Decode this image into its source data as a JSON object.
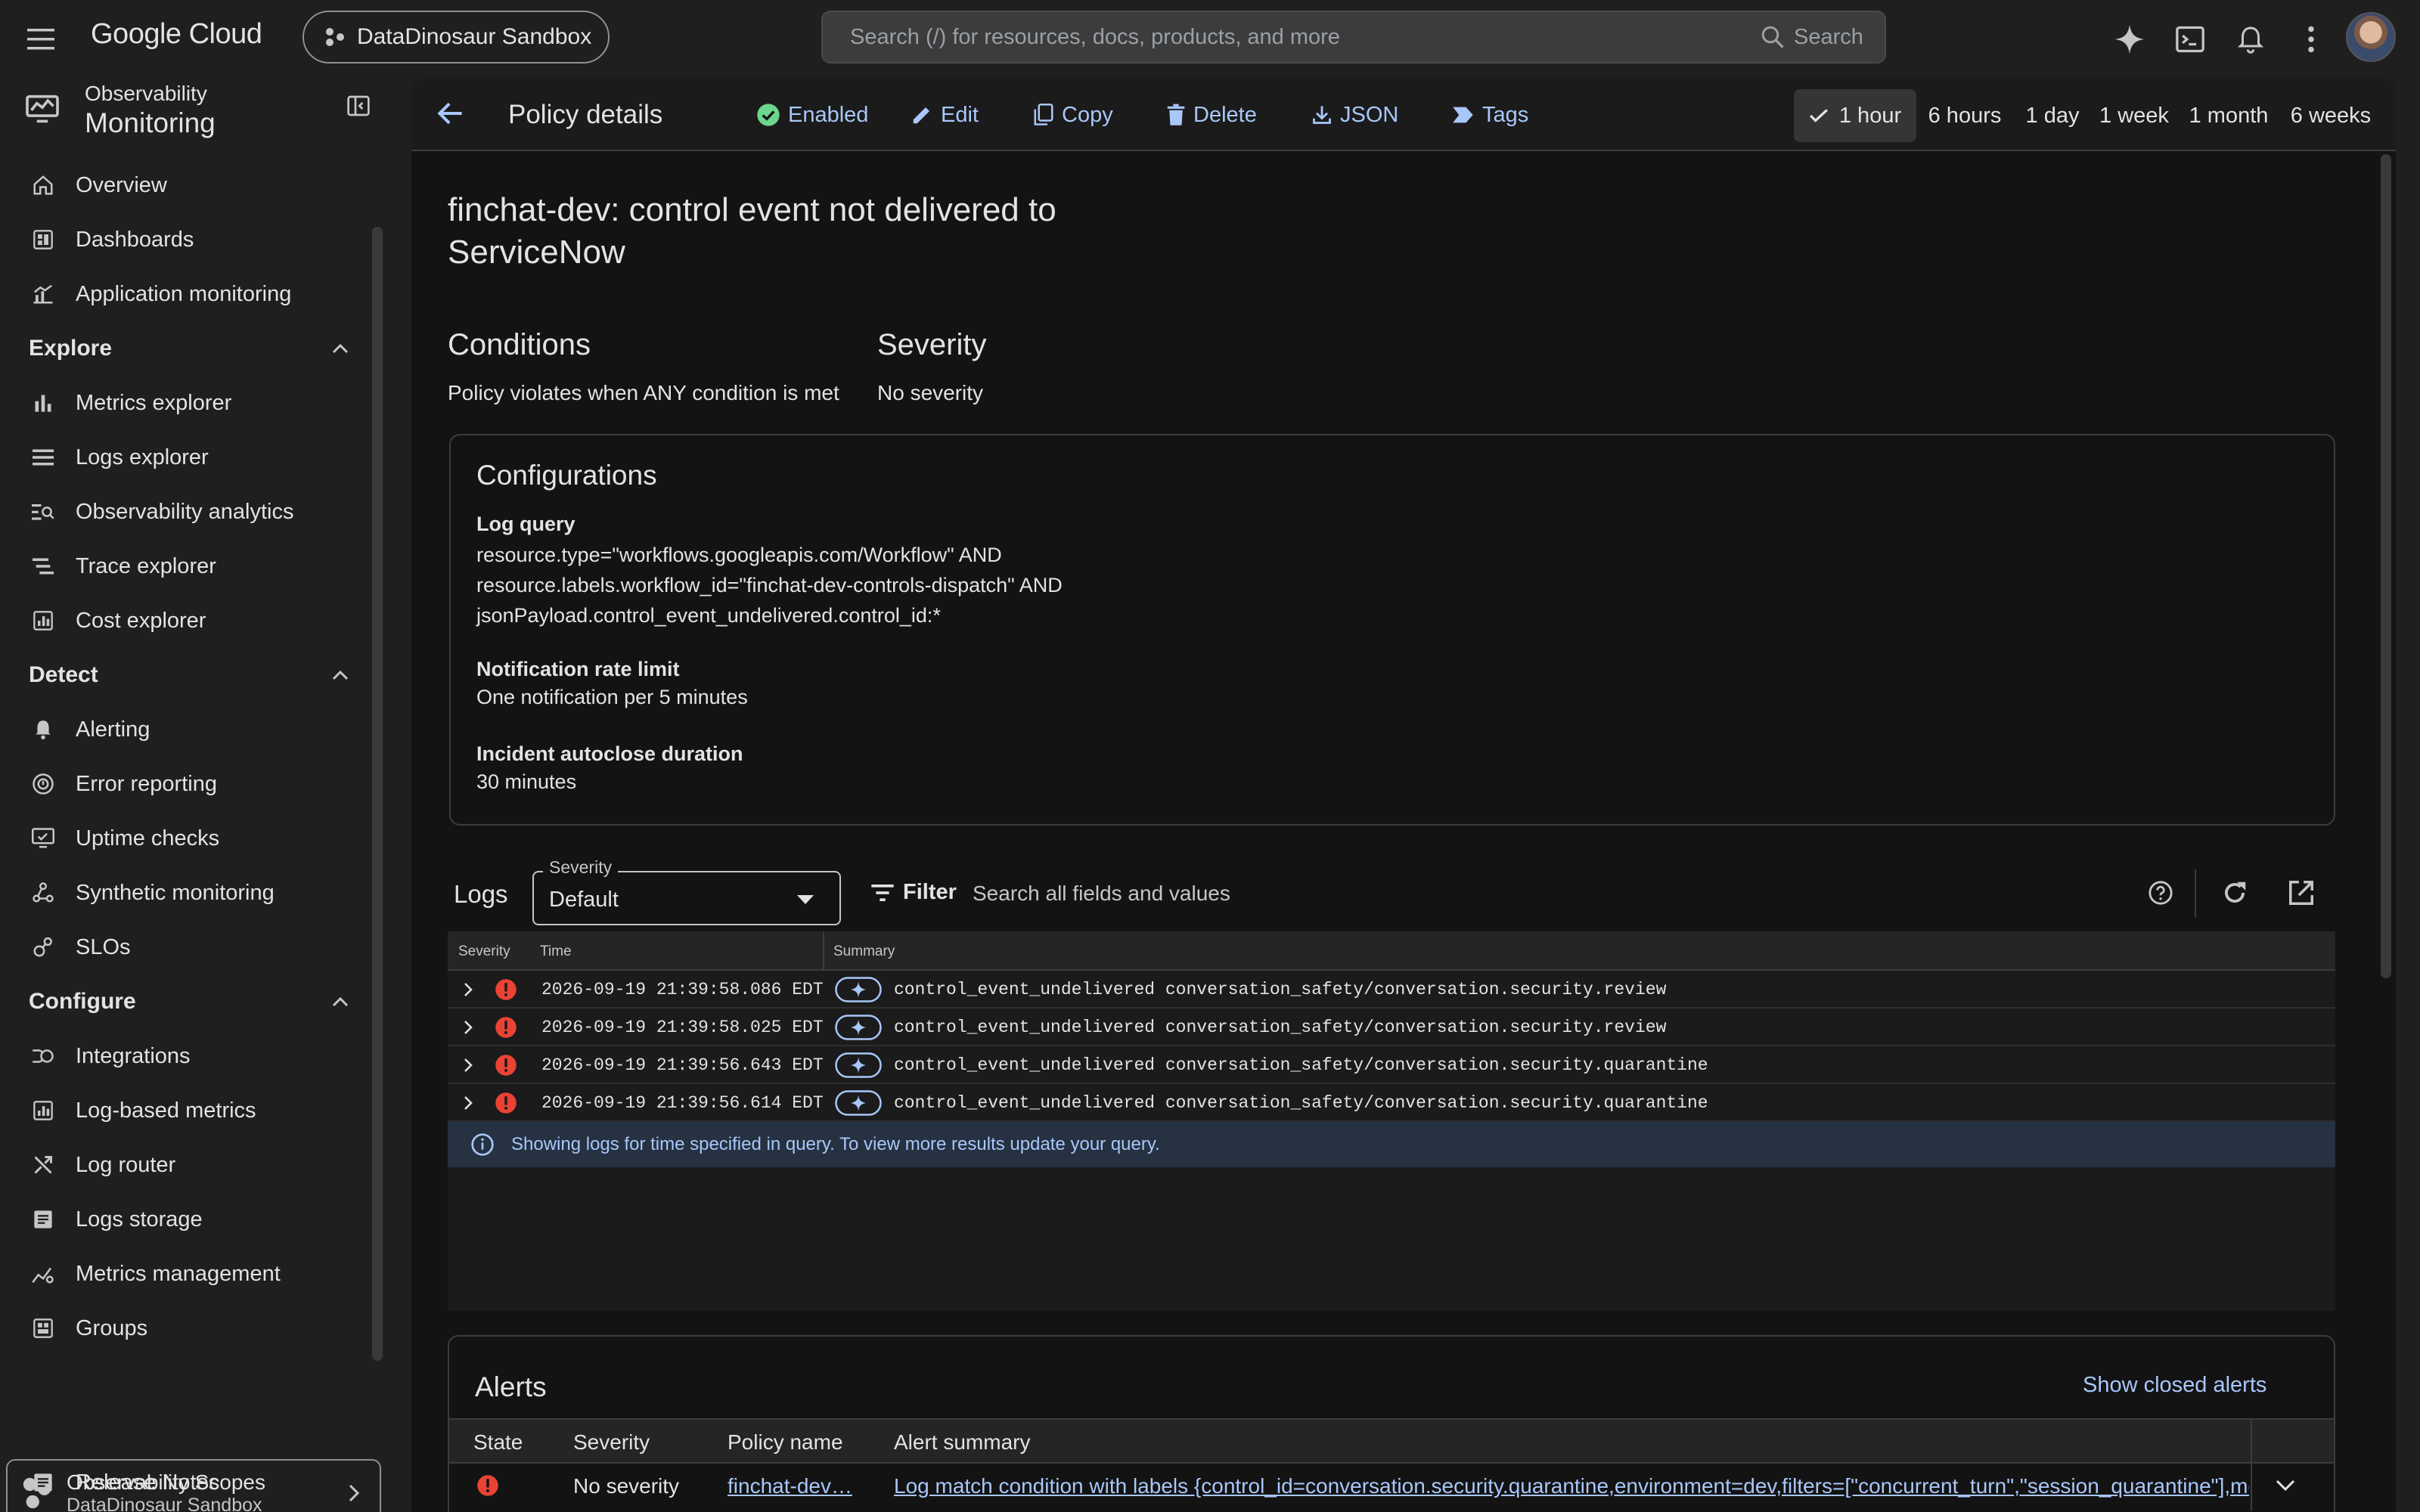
{
  "topbar": {
    "logo": "Google Cloud",
    "project": "DataDinosaur Sandbox",
    "search_placeholder": "Search (/) for resources, docs, products, and more",
    "search_button": "Search"
  },
  "sidebar": {
    "product_sub": "Observability",
    "product_title": "Monitoring",
    "items_top": [
      {
        "label": "Overview",
        "icon": "home-icon"
      },
      {
        "label": "Dashboards",
        "icon": "dashboard-icon"
      },
      {
        "label": "Application monitoring",
        "icon": "app-monitoring-icon"
      }
    ],
    "sections": [
      {
        "title": "Explore",
        "items": [
          {
            "label": "Metrics explorer",
            "icon": "bar-chart-icon"
          },
          {
            "label": "Logs explorer",
            "icon": "list-icon"
          },
          {
            "label": "Observability analytics",
            "icon": "analytics-icon"
          },
          {
            "label": "Trace explorer",
            "icon": "trace-icon"
          },
          {
            "label": "Cost explorer",
            "icon": "cost-icon"
          }
        ]
      },
      {
        "title": "Detect",
        "items": [
          {
            "label": "Alerting",
            "icon": "bell-icon"
          },
          {
            "label": "Error reporting",
            "icon": "error-icon"
          },
          {
            "label": "Uptime checks",
            "icon": "uptime-icon"
          },
          {
            "label": "Synthetic monitoring",
            "icon": "synthetic-icon"
          },
          {
            "label": "SLOs",
            "icon": "slo-icon"
          }
        ]
      },
      {
        "title": "Configure",
        "items": [
          {
            "label": "Integrations",
            "icon": "integrations-icon"
          },
          {
            "label": "Log-based metrics",
            "icon": "log-metrics-icon"
          },
          {
            "label": "Log router",
            "icon": "router-icon"
          },
          {
            "label": "Logs storage",
            "icon": "storage-icon"
          },
          {
            "label": "Metrics management",
            "icon": "metrics-mgmt-icon"
          },
          {
            "label": "Groups",
            "icon": "groups-icon"
          }
        ]
      }
    ],
    "scope_title": "Observability Scopes",
    "scope_sub": "DataDinosaur Sandbox",
    "release_notes": "Release Notes"
  },
  "toolbar": {
    "title": "Policy details",
    "enabled": "Enabled",
    "edit": "Edit",
    "copy": "Copy",
    "delete": "Delete",
    "json": "JSON",
    "tags": "Tags",
    "time_ranges": [
      "1 hour",
      "6 hours",
      "1 day",
      "1 week",
      "1 month",
      "6 weeks"
    ],
    "selected_time_range": "1 hour"
  },
  "policy": {
    "name_line1": "finchat-dev: control event not delivered to",
    "name_line2": "ServiceNow",
    "conditions_title": "Conditions",
    "conditions_value": "Policy violates when ANY condition is met",
    "severity_title": "Severity",
    "severity_value": "No severity"
  },
  "configurations": {
    "title": "Configurations",
    "log_query_label": "Log query",
    "log_query_lines": [
      "resource.type=\"workflows.googleapis.com/Workflow\" AND",
      "resource.labels.workflow_id=\"finchat-dev-controls-dispatch\" AND",
      "jsonPayload.control_event_undelivered.control_id:*"
    ],
    "rate_limit_label": "Notification rate limit",
    "rate_limit_value": "One notification per 5 minutes",
    "autoclose_label": "Incident autoclose duration",
    "autoclose_value": "30 minutes"
  },
  "logs": {
    "title": "Logs",
    "severity_legend": "Severity",
    "severity_value": "Default",
    "filter_label": "Filter",
    "search_placeholder": "Search all fields and values",
    "columns": [
      "Severity",
      "Time",
      "Summary"
    ],
    "rows": [
      {
        "time": "2026-09-19 21:39:58.086 EDT",
        "summary": "control_event_undelivered conversation_safety/conversation.security.review"
      },
      {
        "time": "2026-09-19 21:39:58.025 EDT",
        "summary": "control_event_undelivered conversation_safety/conversation.security.review"
      },
      {
        "time": "2026-09-19 21:39:56.643 EDT",
        "summary": "control_event_undelivered conversation_safety/conversation.security.quarantine"
      },
      {
        "time": "2026-09-19 21:39:56.614 EDT",
        "summary": "control_event_undelivered conversation_safety/conversation.security.quarantine"
      }
    ],
    "info": "Showing logs for time specified in query. To view more results update your query."
  },
  "alerts": {
    "title": "Alerts",
    "show_closed": "Show closed alerts",
    "columns": [
      "State",
      "Severity",
      "Policy name",
      "Alert summary"
    ],
    "row": {
      "severity": "No severity",
      "policy_name": "finchat-dev…",
      "summary": "Log match condition with labels {control_id=conversation.security.quarantine,environment=dev,filters=[\"concurrent_turn\",\"session_quarantine\"],me"
    }
  },
  "colors": {
    "accent": "#a8c7fa",
    "error": "#ea4335",
    "enabled": "#6dd58c"
  }
}
